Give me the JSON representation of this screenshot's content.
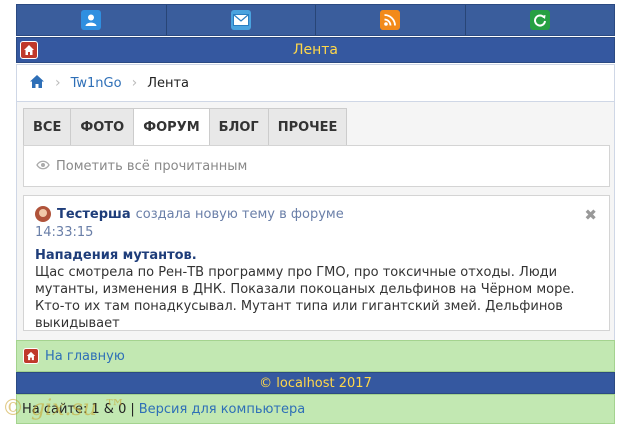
{
  "topbar": {
    "icons": [
      {
        "name": "user-icon",
        "color": "#2f8fe0"
      },
      {
        "name": "mail-icon",
        "color": "#4aa3df"
      },
      {
        "name": "rss-icon",
        "color": "#f28a1a"
      },
      {
        "name": "refresh-icon",
        "color": "#27a043"
      }
    ]
  },
  "header": {
    "title": "Лента"
  },
  "breadcrumb": {
    "home_icon": "home-icon",
    "site": "Tw1nGo",
    "current": "Лента"
  },
  "tabs": [
    {
      "label": "ВСЕ",
      "active": false
    },
    {
      "label": "ФОТО",
      "active": false
    },
    {
      "label": "ФОРУМ",
      "active": true
    },
    {
      "label": "БЛОГ",
      "active": false
    },
    {
      "label": "ПРОЧЕЕ",
      "active": false
    }
  ],
  "mark_all": {
    "label": "Пометить всё прочитанным"
  },
  "post": {
    "user": "Тестерша",
    "action": "создала новую тему в форуме",
    "time": "14:33:15",
    "title": "Нападения мутантов.",
    "body": "Щас смотрела по Рен-ТВ программу про ГМО, про токсичные отходы. Люди мутанты, изменения в ДНК. Показали покоцаных дельфинов на Чёрном море. Кто-то их там понадкусывал. Мутант типа или гигантский змей. Дельфинов выкидывает"
  },
  "footer": {
    "home_label": "На главную",
    "copyright": "© localhost 2017",
    "online_label": "На сайте:",
    "online_value": "1 & 0",
    "desktop_link": "Версия для компьютера",
    "watermark": "© gix.su ™"
  },
  "colors": {
    "accent": "#3558a0",
    "title_text": "#ffd84a",
    "green_bar": "#c2e8b2"
  }
}
